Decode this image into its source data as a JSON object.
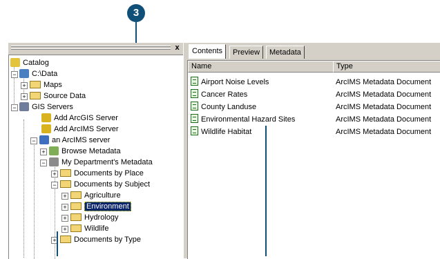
{
  "callout": {
    "number": "3"
  },
  "catalog_header": {
    "close": "x"
  },
  "tree": {
    "catalog": "Catalog",
    "c_data": "C:\\Data",
    "maps": "Maps",
    "source_data": "Source Data",
    "gis_servers": "GIS Servers",
    "add_arcgis": "Add ArcGIS Server",
    "add_arcims": "Add ArcIMS Server",
    "arcims_server": "an ArcIMS server",
    "browse_metadata": "Browse Metadata",
    "my_dept_metadata": "My Department's Metadata",
    "docs_by_place": "Documents by Place",
    "docs_by_subject": "Documents by Subject",
    "agriculture": "Agriculture",
    "environment": "Environment",
    "hydrology": "Hydrology",
    "wildlife": "Wildlife",
    "docs_by_type": "Documents by Type"
  },
  "tabs": [
    "Contents",
    "Preview",
    "Metadata"
  ],
  "columns": {
    "name": "Name",
    "type": "Type"
  },
  "rows": [
    {
      "name": "Airport Noise Levels",
      "type": "ArcIMS Metadata Document"
    },
    {
      "name": "Cancer Rates",
      "type": "ArcIMS Metadata Document"
    },
    {
      "name": "County Landuse",
      "type": "ArcIMS Metadata Document"
    },
    {
      "name": "Environmental Hazard Sites",
      "type": "ArcIMS Metadata Document"
    },
    {
      "name": "Wildlife Habitat",
      "type": "ArcIMS Metadata Document"
    }
  ],
  "colors": {
    "callout": "#0f4f78",
    "selection": "#0a246a",
    "chrome": "#d4d0c8"
  }
}
